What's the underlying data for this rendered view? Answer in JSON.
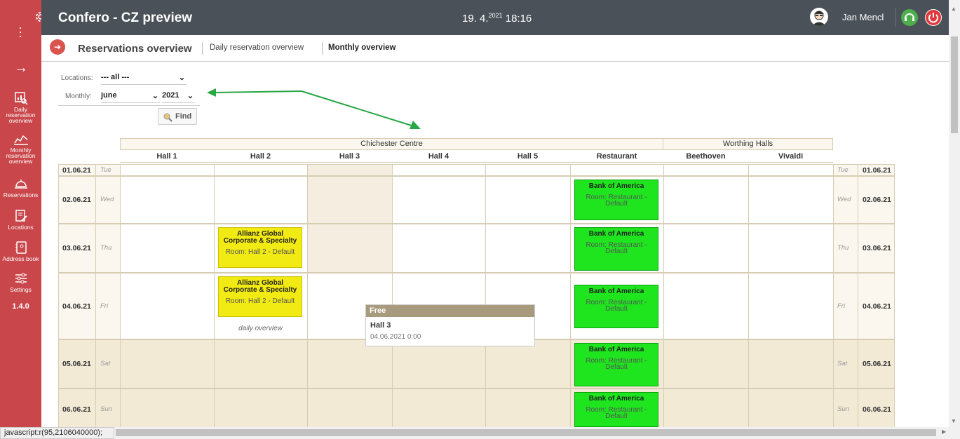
{
  "app": {
    "title": "Confero - CZ preview",
    "date": "19. 4.",
    "year_sup": "2021",
    "time": "18:16",
    "user": "Jan Mencl",
    "version": "1.4.0"
  },
  "sidebar": {
    "items": [
      {
        "label1": "Daily",
        "label2": "reservation",
        "label3": "overview"
      },
      {
        "label1": "Monthly",
        "label2": "reservation",
        "label3": "overview"
      },
      {
        "label1": "Reservations"
      },
      {
        "label1": "Locations"
      },
      {
        "label1": "Address book"
      },
      {
        "label1": "Settings"
      }
    ]
  },
  "subnav": {
    "title": "Reservations overview",
    "link_daily": "Daily reservation overview",
    "link_monthly": "Monthly overview"
  },
  "filters": {
    "locations_label": "Locations:",
    "locations_value": "--- all ---",
    "monthly_label": "Monthly:",
    "month_value": "june",
    "year_value": "2021",
    "find_label": "Find"
  },
  "calendar": {
    "groups": [
      "Chichester Centre",
      "Worthing Halls"
    ],
    "halls": [
      "Hall 1",
      "Hall 2",
      "Hall 3",
      "Hall 4",
      "Hall 5",
      "Restaurant",
      "Beethoven",
      "Vivaldi"
    ],
    "rows": [
      {
        "date": "01.06.21",
        "day": "Tue"
      },
      {
        "date": "02.06.21",
        "day": "Wed"
      },
      {
        "date": "03.06.21",
        "day": "Thu"
      },
      {
        "date": "04.06.21",
        "day": "Fri"
      },
      {
        "date": "05.06.21",
        "day": "Sat"
      },
      {
        "date": "06.06.21",
        "day": "Sun"
      }
    ],
    "events": {
      "boa_title": "Bank of America",
      "boa_room1": "Room: Restaurant -",
      "boa_room2": "Default",
      "allianz_title1": "Allianz Global",
      "allianz_title2": "Corporate & Specialty",
      "allianz_room": "Room: Hall 2 - Default"
    },
    "daily_overview_link": "daily overview"
  },
  "tooltip": {
    "status": "Free",
    "hall": "Hall 3",
    "datetime": "04.06.2021 0:00"
  },
  "statusbar": {
    "text": "javascript:r(95,2106040000);"
  }
}
